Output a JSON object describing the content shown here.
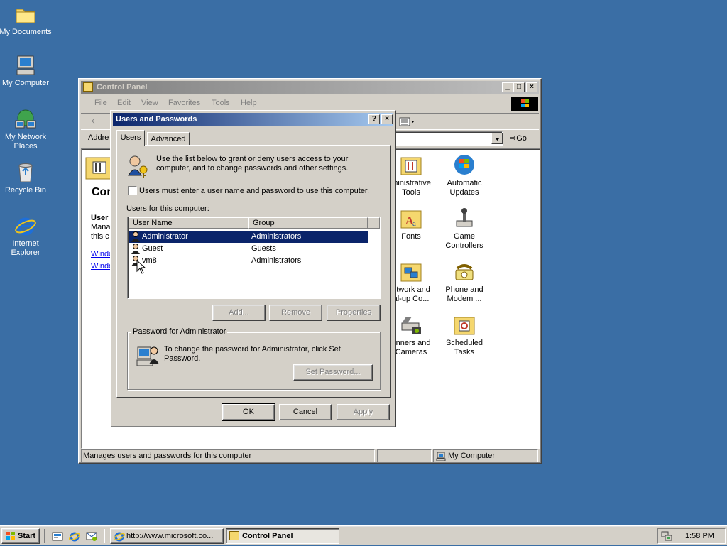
{
  "desktop": {
    "icons": [
      {
        "label_line1": "My Documents",
        "label_line2": ""
      },
      {
        "label_line1": "My Computer",
        "label_line2": ""
      },
      {
        "label_line1": "My Network",
        "label_line2": "Places"
      },
      {
        "label_line1": "Recycle Bin",
        "label_line2": ""
      },
      {
        "label_line1": "Internet",
        "label_line2": "Explorer"
      }
    ]
  },
  "control_panel": {
    "title": "Control Panel",
    "menu": [
      "File",
      "Edit",
      "View",
      "Favorites",
      "Tools",
      "Help"
    ],
    "back_label": "B",
    "address_label": "Addre",
    "go_label": "Go",
    "left_pane": {
      "heading": "Cor",
      "desc_title": "User",
      "desc_line1": "Mana",
      "desc_line2": "this c",
      "link1": "Windo",
      "link2": "Windo"
    },
    "icons": [
      {
        "label_line1": "ministrative",
        "label_line2": "Tools"
      },
      {
        "label_line1": "Automatic",
        "label_line2": "Updates"
      },
      {
        "label_line1": "Fonts",
        "label_line2": ""
      },
      {
        "label_line1": "Game",
        "label_line2": "Controllers"
      },
      {
        "label_line1": "etwork and",
        "label_line2": "al-up Co..."
      },
      {
        "label_line1": "Phone and",
        "label_line2": "Modem ..."
      },
      {
        "label_line1": "anners and",
        "label_line2": "Cameras"
      },
      {
        "label_line1": "Scheduled",
        "label_line2": "Tasks"
      }
    ],
    "status_text": "Manages users and passwords for this computer",
    "status_zone": "My Computer"
  },
  "dialog": {
    "title": "Users and Passwords",
    "help_btn": "?",
    "close_btn": "×",
    "tabs": [
      "Users",
      "Advanced"
    ],
    "intro_line1": "Use the list below to grant or deny users access to your",
    "intro_line2": "computer, and to change passwords and other settings.",
    "checkbox_label": "Users must enter a user name and password to use this computer.",
    "checkbox_checked": false,
    "list_label": "Users for this computer:",
    "columns": [
      "User Name",
      "Group"
    ],
    "users": [
      {
        "name": "Administrator",
        "group": "Administrators",
        "selected": true
      },
      {
        "name": "Guest",
        "group": "Guests",
        "selected": false
      },
      {
        "name": "vm8",
        "group": "Administrators",
        "selected": false
      }
    ],
    "buttons": {
      "add": "Add...",
      "remove": "Remove",
      "properties": "Properties"
    },
    "pw_group_label": "Password for Administrator",
    "pw_text_line1": "To change the password for Administrator, click Set",
    "pw_text_line2": "Password.",
    "set_password": "Set Password...",
    "ok": "OK",
    "cancel": "Cancel",
    "apply": "Apply"
  },
  "taskbar": {
    "start": "Start",
    "tasks": [
      "http://www.microsoft.co...",
      "Control Panel"
    ],
    "clock": "1:58 PM"
  },
  "colors": {
    "desktop": "#3a6ea5",
    "selection": "#0a246a",
    "face": "#d4d0c8"
  }
}
